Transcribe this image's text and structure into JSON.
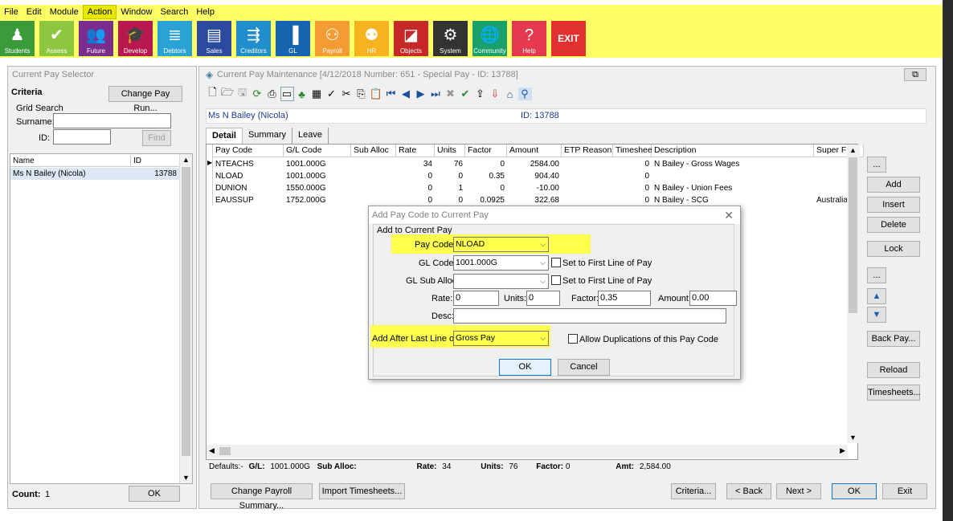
{
  "menu": [
    "File",
    "Edit",
    "Module",
    "Action",
    "Window",
    "Search",
    "Help"
  ],
  "toolbar": [
    {
      "label": "Students",
      "color": "#3a9b3a",
      "icon": "person-icon"
    },
    {
      "label": "Assess",
      "color": "#8dc63f",
      "icon": "check-icon"
    },
    {
      "label": "Future",
      "color": "#7b2d8e",
      "icon": "people-icon"
    },
    {
      "label": "Develop",
      "color": "#b8174f",
      "icon": "graduation-cap-icon"
    },
    {
      "label": "Debtors",
      "color": "#29a3d6",
      "icon": "coins-icon"
    },
    {
      "label": "Sales",
      "color": "#2c4a9e",
      "icon": "register-icon"
    },
    {
      "label": "Creditors",
      "color": "#1f8ecb",
      "icon": "money-icon"
    },
    {
      "label": "GL",
      "color": "#1565b0",
      "icon": "bar-chart-icon"
    },
    {
      "label": "Payroll",
      "color": "#f39c33",
      "icon": "payroll-people-icon"
    },
    {
      "label": "HR",
      "color": "#f6b21f",
      "icon": "hr-people-icon"
    },
    {
      "label": "Objects",
      "color": "#c62828",
      "icon": "objects-icon"
    },
    {
      "label": "System",
      "color": "#333333",
      "icon": "gear-icon"
    },
    {
      "label": "Community",
      "color": "#1aa06b",
      "icon": "globe-icon"
    },
    {
      "label": "Help",
      "color": "#e53950",
      "icon": "question-icon"
    },
    {
      "label": "EXIT",
      "color": "#e03030",
      "icon": ""
    }
  ],
  "left": {
    "title": "Current Pay Selector",
    "criteria": "Criteria",
    "change_pay_run": "Change Pay Run...",
    "grid_search": "Grid Search",
    "surname_label": "Surname:",
    "surname_value": "",
    "id_label": "ID:",
    "id_value": "",
    "find": "Find",
    "col_name": "Name",
    "col_id": "ID",
    "row_name": "Ms N Bailey  (Nicola)",
    "row_id": "13788",
    "count_label": "Count:",
    "count_value": "1",
    "ok": "OK"
  },
  "main": {
    "title": "Current Pay Maintenance  [4/12/2018  Number: 651 - Special Pay - ID: 13788]",
    "employee_name": "Ms N Bailey  (Nicola)",
    "employee_id": "ID: 13788",
    "tabs": [
      "Detail",
      "Summary",
      "Leave"
    ],
    "columns": [
      "Pay Code",
      "G/L Code",
      "Sub Alloc",
      "Rate",
      "Units",
      "Factor",
      "Amount",
      "ETP Reason",
      "Timesheets",
      "Description",
      "Super Fu"
    ],
    "rows": [
      [
        "NTEACHS",
        "1001.000G",
        "",
        "34",
        "76",
        "0",
        "2584.00",
        "",
        "0",
        "N Bailey - Gross Wages",
        ""
      ],
      [
        "NLOAD",
        "1001.000G",
        "",
        "0",
        "0",
        "0.35",
        "904.40",
        "",
        "0",
        "",
        ""
      ],
      [
        "DUNION",
        "1550.000G",
        "",
        "0",
        "1",
        "0",
        "-10.00",
        "",
        "0",
        "N Bailey - Union Fees",
        ""
      ],
      [
        "EAUSSUP",
        "1752.000G",
        "",
        "0",
        "0",
        "0.0925",
        "322.68",
        "",
        "0",
        "N Bailey - SCG",
        "Australia"
      ]
    ],
    "side_buttons": {
      "more1": "...",
      "add": "Add",
      "insert": "Insert",
      "delete": "Delete",
      "lock": "Lock",
      "more2": "...",
      "back_pay": "Back Pay...",
      "reload": "Reload",
      "timesheets": "Timesheets..."
    },
    "status": {
      "defaults": "Defaults:-",
      "gl_label": "G/L:",
      "gl_value": "1001.000G",
      "sub_label": "Sub Alloc:",
      "rate_label": "Rate:",
      "rate_value": "34",
      "units_label": "Units:",
      "units_value": "76",
      "factor_label": "Factor:",
      "factor_value": "0",
      "amt_label": "Amt:",
      "amt_value": "2,584.00"
    },
    "bottom": {
      "change_summary": "Change Payroll Summary...",
      "import_ts": "Import Timesheets...",
      "criteria": "Criteria...",
      "back": "< Back",
      "next": "Next >",
      "ok": "OK",
      "exit": "Exit"
    }
  },
  "dialog": {
    "title": "Add Pay Code to Current Pay",
    "group": "Add to Current Pay",
    "pay_code_label": "Pay Code:",
    "pay_code_value": "NLOAD",
    "gl_code_label": "GL Code:",
    "gl_code_value": "1001.000G",
    "set_first1": "Set to First Line of Pay",
    "gl_sub_label": "GL Sub Alloc:",
    "gl_sub_value": "",
    "set_first2": "Set to First Line of Pay",
    "rate_label": "Rate:",
    "rate_value": "0",
    "units_label": "Units:",
    "units_value": "0",
    "factor_label": "Factor:",
    "factor_value": "0.35",
    "amount_label": "Amount:",
    "amount_value": "0.00",
    "desc_label": "Desc:",
    "desc_value": "",
    "after_label": "Add After Last Line of:",
    "after_value": "Gross Pay",
    "allow_dup": "Allow Duplications of this Pay Code",
    "ok": "OK",
    "cancel": "Cancel"
  }
}
